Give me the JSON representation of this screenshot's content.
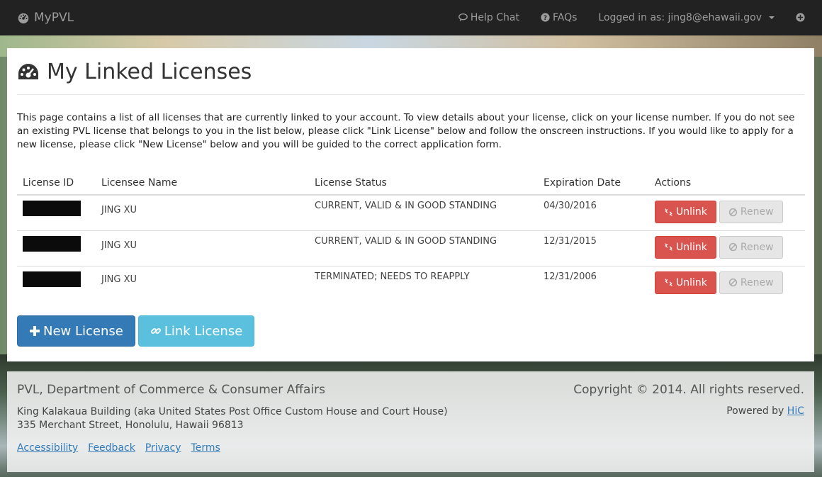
{
  "nav": {
    "brand": "MyPVL",
    "help_chat": "Help Chat",
    "faqs": "FAQs",
    "logged_in": "Logged in as: jing8@ehawaii.gov"
  },
  "page": {
    "title": "My Linked Licenses",
    "intro": "This page contains a list of all licenses that are currently linked to your account. To view details about your license, click on your license number. If you do not see an existing PVL license that belongs to you in the list below, please click \"Link License\" below and follow the onscreen instructions. If you would like to apply for a new license, please click \"New License\" below and you will be guided to the correct application form."
  },
  "table": {
    "headers": [
      "License ID",
      "Licensee Name",
      "License Status",
      "Expiration Date",
      "Actions"
    ],
    "rows": [
      {
        "name": "JING XU",
        "status": "CURRENT, VALID & IN GOOD STANDING",
        "expiration": "04/30/2016"
      },
      {
        "name": "JING XU",
        "status": "CURRENT, VALID & IN GOOD STANDING",
        "expiration": "12/31/2015"
      },
      {
        "name": "JING XU",
        "status": "TERMINATED; NEEDS TO REAPPLY",
        "expiration": "12/31/2006"
      }
    ],
    "unlink_label": "Unlink",
    "renew_label": "Renew"
  },
  "buttons": {
    "new_license": "New License",
    "link_license": "Link License"
  },
  "footer": {
    "org": "PVL, Department of Commerce & Consumer Affairs",
    "copyright": "Copyright © 2014. All rights reserved.",
    "address_line1": "King Kalakaua Building (aka United States Post Office Custom House and Court House)",
    "address_line2": "335 Merchant Street, Honolulu, Hawaii 96813",
    "powered_by": "Powered by",
    "powered_link": "HiC",
    "links": [
      "Accessibility",
      "Feedback",
      "Privacy",
      "Terms"
    ]
  },
  "colors": {
    "navbar": "#222222",
    "danger": "#d9534f",
    "primary": "#337ab7",
    "info": "#5bc0de"
  }
}
